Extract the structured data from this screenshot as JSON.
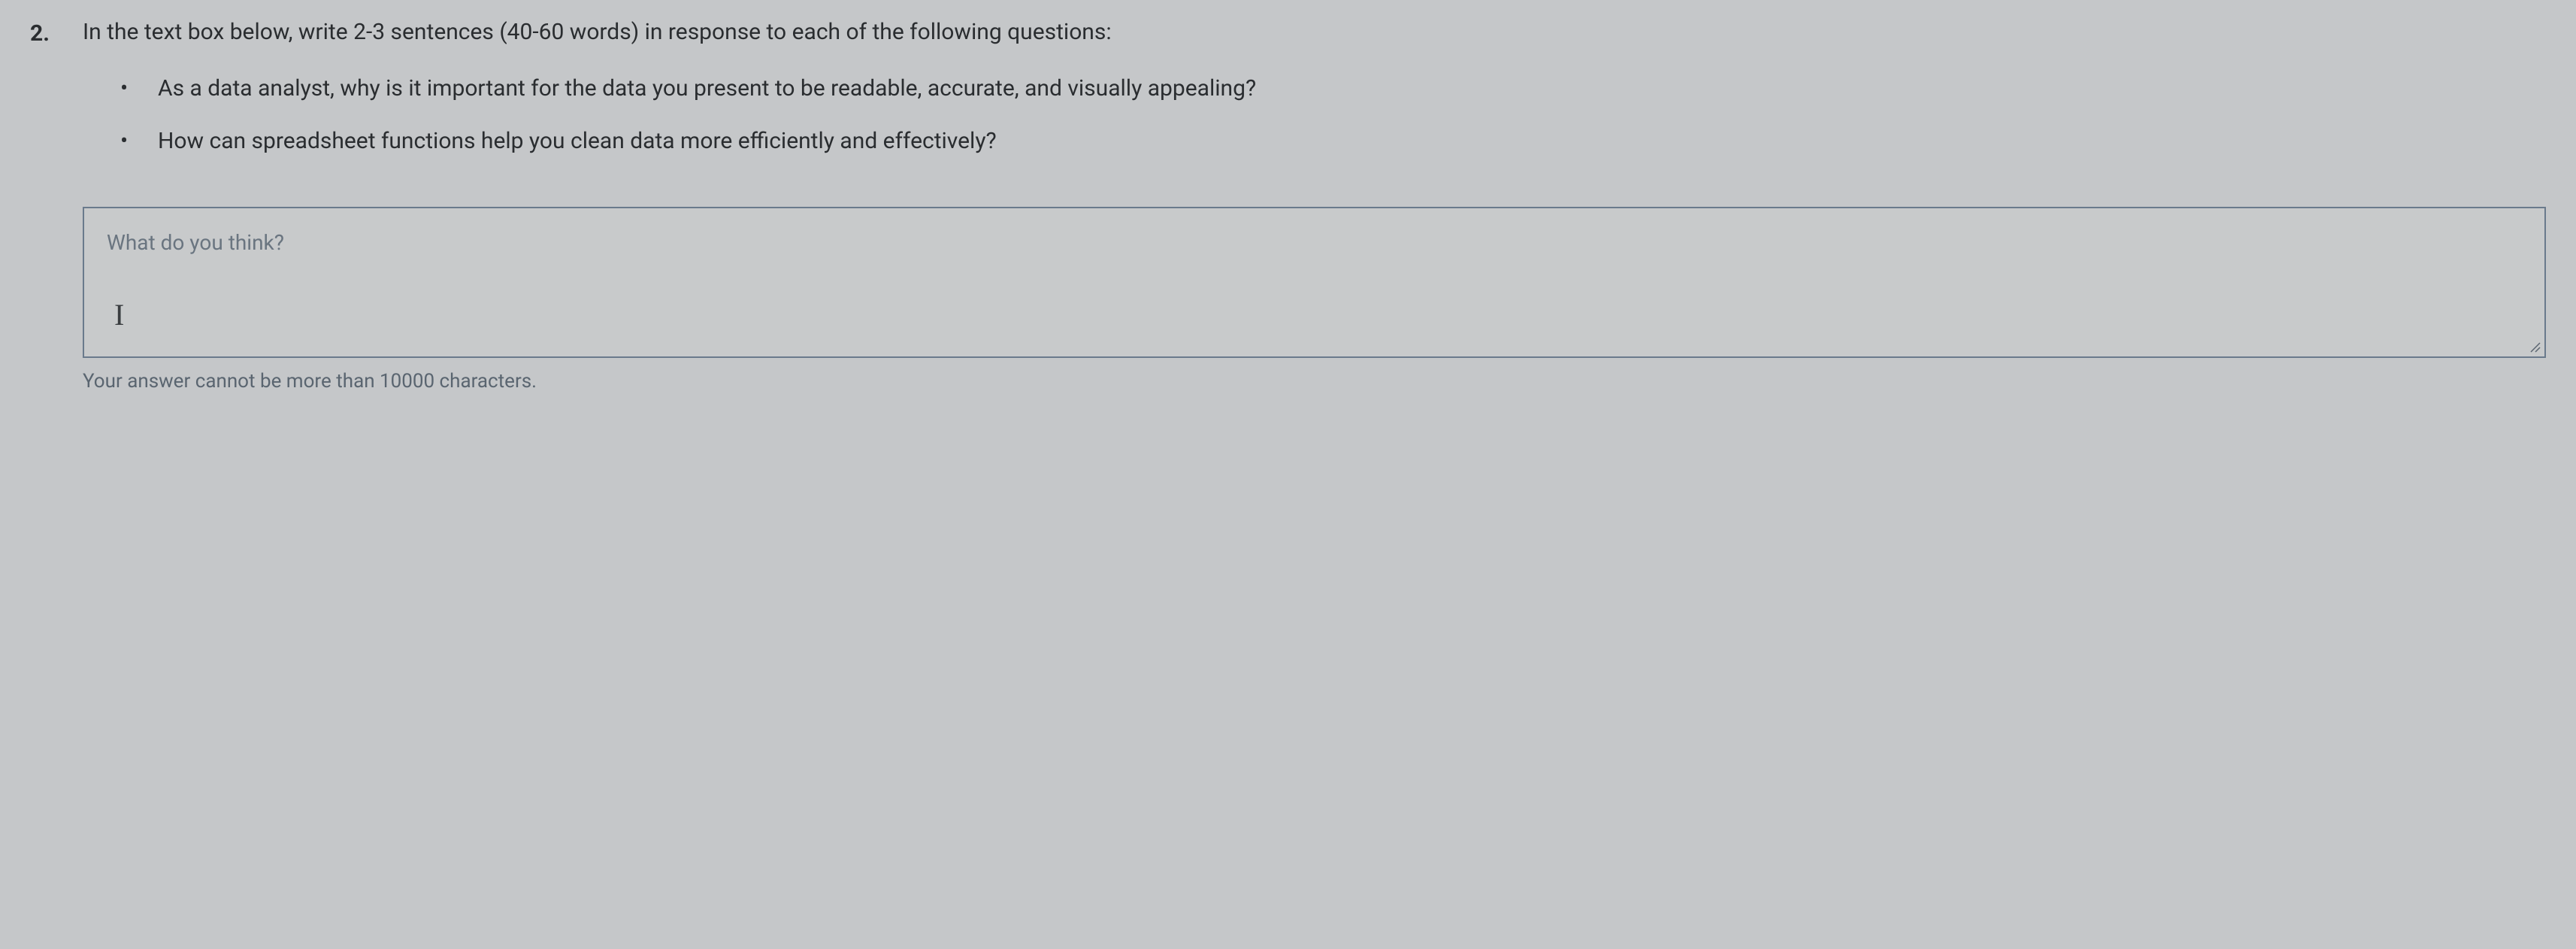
{
  "question": {
    "number": "2.",
    "prompt": "In the text box below, write 2-3 sentences (40-60 words) in response to each of the following questions:",
    "bullets": [
      "As a data analyst, why is it important for the data you present to be readable, accurate, and visually appealing?",
      "How can spreadsheet functions help you clean data more efficiently and effectively?"
    ]
  },
  "input": {
    "placeholder": "What do you think?",
    "value": "",
    "cursor_glyph": "I"
  },
  "hint": "Your answer cannot be more than 10000 characters."
}
